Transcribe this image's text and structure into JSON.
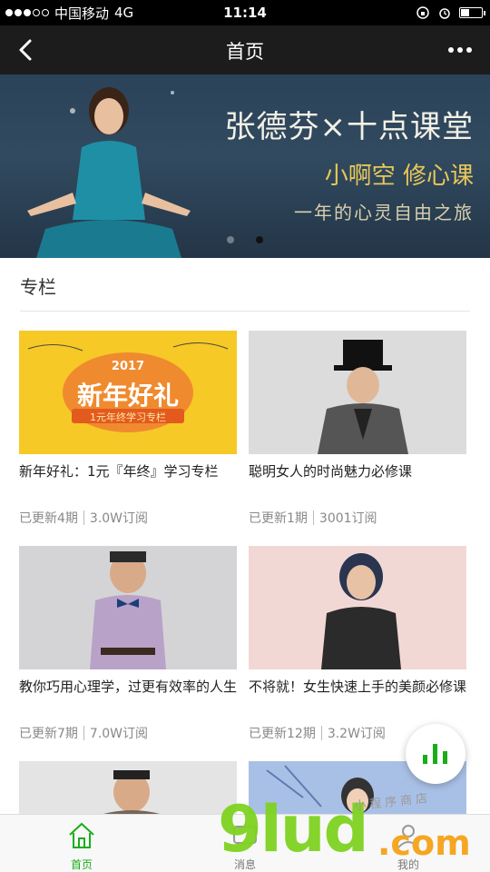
{
  "statusbar": {
    "carrier": "中国移动",
    "network": "4G",
    "time": "11:14"
  },
  "nav": {
    "title": "首页"
  },
  "banner": {
    "title": "张德芬×十点课堂",
    "subtitle": "小啊空 修心课",
    "tagline": "一年的心灵自由之旅"
  },
  "section": {
    "title": "专栏"
  },
  "cards": [
    {
      "thumb_title": "新年好礼",
      "thumb_year": "2017",
      "thumb_sub": "1元年终学习专栏",
      "title": "新年好礼：1元『年终』学习专栏",
      "updates": "已更新4期",
      "subs": "3.0W订阅"
    },
    {
      "title": "聪明女人的时尚魅力必修课",
      "updates": "已更新1期",
      "subs": "3001订阅"
    },
    {
      "title": "教你巧用心理学，过更有效率的人生",
      "updates": "已更新7期",
      "subs": "7.0W订阅"
    },
    {
      "title": "不将就！女生快速上手的美颜必修课",
      "updates": "已更新12期",
      "subs": "3.2W订阅"
    }
  ],
  "tabs": [
    {
      "label": "首页"
    },
    {
      "label": "消息"
    },
    {
      "label": "我的"
    }
  ],
  "watermark": {
    "brand": "9lud",
    "domain": ".com",
    "caption": "小程序商店"
  },
  "colors": {
    "accent": "#1aad19",
    "navbar": "#1c1c1c",
    "tab_active": "#1aad19"
  }
}
